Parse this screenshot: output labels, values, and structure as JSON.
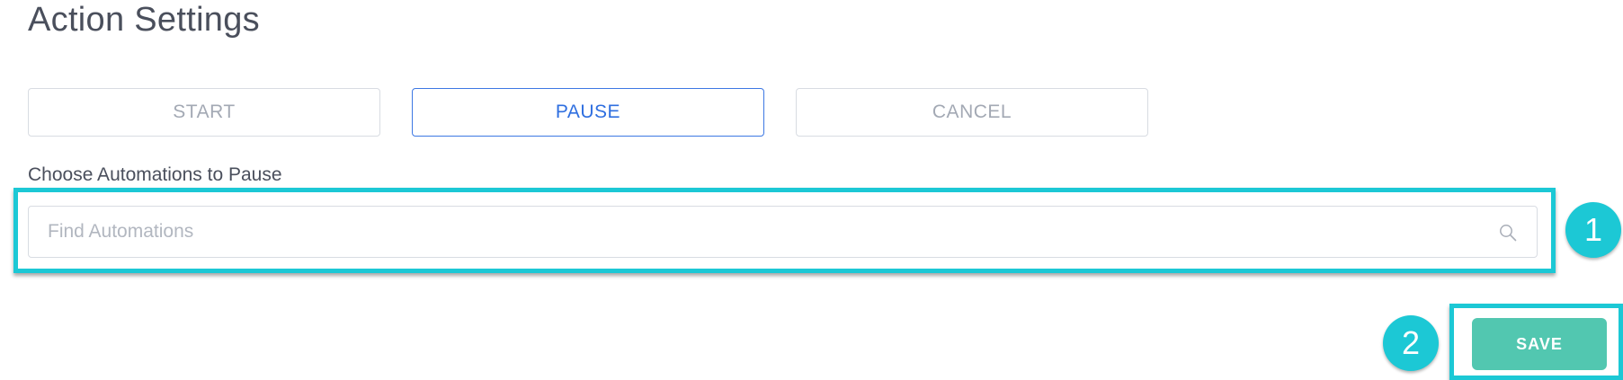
{
  "header": {
    "title": "Action Settings"
  },
  "actions": {
    "start_label": "START",
    "pause_label": "PAUSE",
    "cancel_label": "CANCEL",
    "selected": "PAUSE"
  },
  "automations": {
    "label": "Choose Automations to Pause",
    "search_placeholder": "Find Automations",
    "search_value": ""
  },
  "footer": {
    "save_label": "SAVE"
  },
  "callouts": {
    "badge_1": "1",
    "badge_2": "2"
  },
  "icons": {
    "search": "search-icon"
  },
  "colors": {
    "accent_blue": "#2f6fe0",
    "highlight_cyan": "#1cc8d5",
    "save_green": "#52c7b0",
    "muted_text": "#a3a9b4",
    "title_text": "#4a4f5c"
  }
}
